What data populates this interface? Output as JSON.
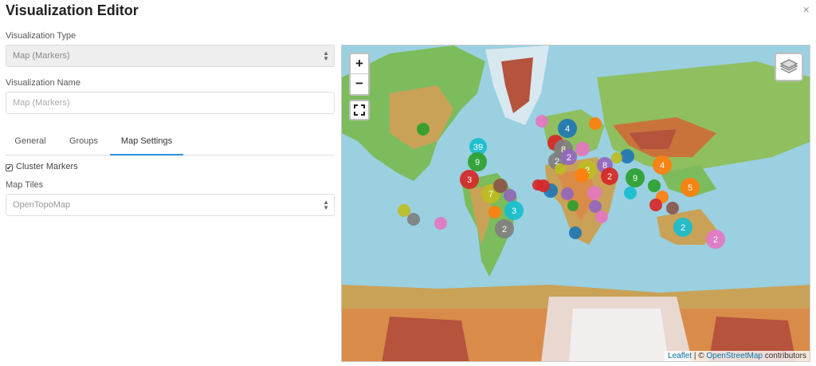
{
  "header": {
    "title": "Visualization Editor",
    "close": "×"
  },
  "form": {
    "type_label": "Visualization Type",
    "type_value": "Map (Markers)",
    "name_label": "Visualization Name",
    "name_placeholder": "Map (Markers)"
  },
  "tabs": [
    {
      "label": "General"
    },
    {
      "label": "Groups"
    },
    {
      "label": "Map Settings",
      "active": true
    }
  ],
  "settings": {
    "cluster_label": "Cluster Markers",
    "cluster_checked": true,
    "tiles_label": "Map Tiles",
    "tiles_value": "OpenTopoMap"
  },
  "map": {
    "zoom_in": "+",
    "zoom_out": "−",
    "attribution_leaflet": "Leaflet",
    "attribution_sep": " | © ",
    "attribution_osm": "OpenStreetMap",
    "attribution_tail": " contributors",
    "marker_labels": [
      "4",
      "8",
      "2",
      "2",
      "8",
      "2",
      "2",
      "9",
      "4",
      "39",
      "9",
      "3",
      "7",
      "3",
      "2",
      "5",
      "2"
    ],
    "colors": {
      "blue": "#1f77b4",
      "orange": "#ff7f0e",
      "green": "#2ca02c",
      "red": "#d62728",
      "purple": "#9467bd",
      "brown": "#8c564b",
      "pink": "#e377c2",
      "gray": "#7f7f7f",
      "olive": "#bcbd22",
      "cyan": "#17becf"
    }
  }
}
